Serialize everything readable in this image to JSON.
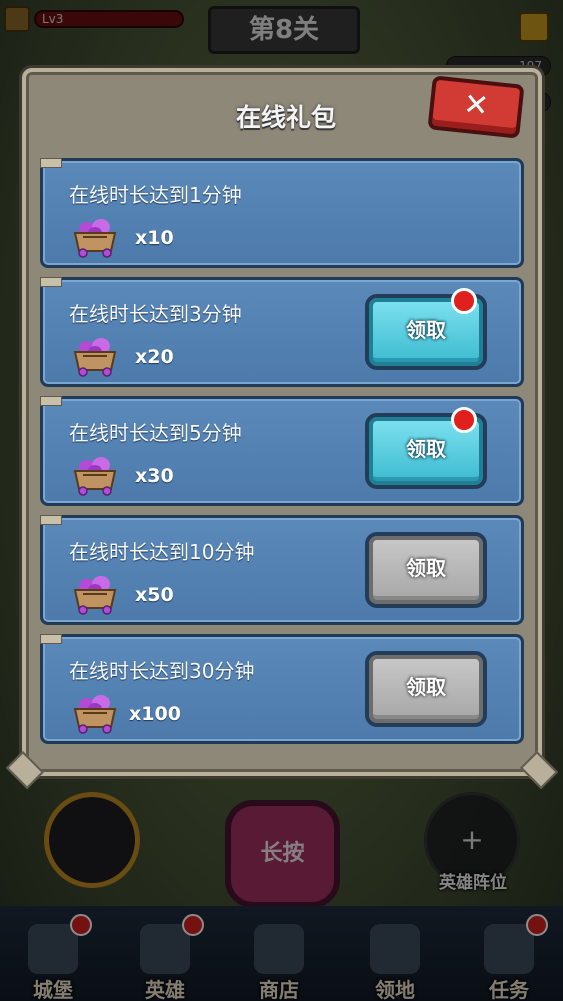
{
  "hud": {
    "level": "Lv3",
    "stage_title": "第8关",
    "resource_1": "197"
  },
  "dialog": {
    "title": "在线礼包",
    "close_label": "✕",
    "rewards": [
      {
        "condition": "在线时长达到1分钟",
        "quantity": "x10",
        "claim_label": "",
        "state": "claimed"
      },
      {
        "condition": "在线时长达到3分钟",
        "quantity": "x20",
        "claim_label": "领取",
        "state": "available"
      },
      {
        "condition": "在线时长达到5分钟",
        "quantity": "x30",
        "claim_label": "领取",
        "state": "available"
      },
      {
        "condition": "在线时长达到10分钟",
        "quantity": "x50",
        "claim_label": "领取",
        "state": "locked"
      },
      {
        "condition": "在线时长达到30分钟",
        "quantity": "x100",
        "claim_label": "领取",
        "state": "locked"
      }
    ]
  },
  "bottom": {
    "long_press_label": "长按",
    "formation_plus": "+",
    "formation_label": "英雄阵位"
  },
  "nav": {
    "items": [
      {
        "label": "城堡",
        "icon": "castle-icon"
      },
      {
        "label": "英雄",
        "icon": "hero-helmet-icon"
      },
      {
        "label": "商店",
        "icon": "shop-icon"
      },
      {
        "label": "领地",
        "icon": "territory-icon"
      },
      {
        "label": "任务",
        "icon": "quest-book-icon"
      }
    ]
  },
  "colors": {
    "card_blue": "#5a89ba",
    "button_active": "#3bb9cf",
    "button_disabled": "#a5a5a5",
    "close_red": "#d23a34",
    "badge_red": "#e0201c"
  }
}
